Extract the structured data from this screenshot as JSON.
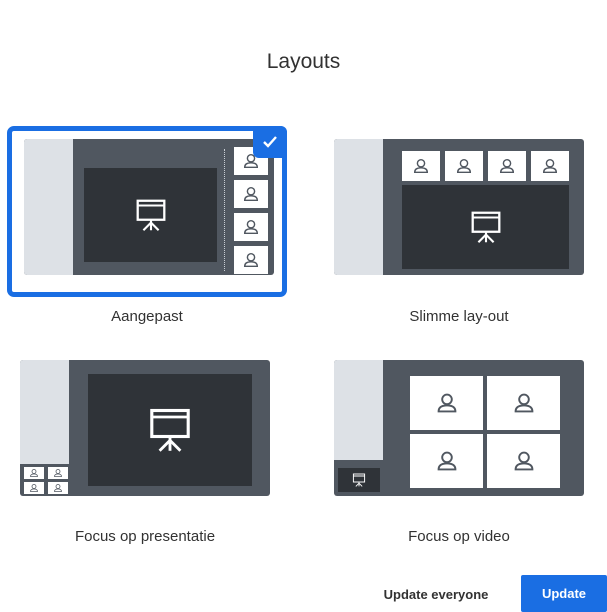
{
  "dialog": {
    "title": "Layouts"
  },
  "layouts": [
    {
      "label": "Aangepast",
      "selected": true
    },
    {
      "label": "Slimme lay-out",
      "selected": false
    },
    {
      "label": "Focus op presentatie",
      "selected": false
    },
    {
      "label": "Focus op video",
      "selected": false
    }
  ],
  "footer": {
    "update_everyone_label": "Update everyone",
    "update_label": "Update"
  },
  "colors": {
    "accent": "#1a6ee3",
    "thumb_bg": "#505760",
    "screen": "#2f3338",
    "sidebar": "#dde1e6"
  },
  "icons": {
    "presentation": "presentation-board-icon",
    "person": "person-icon",
    "check": "check-icon"
  }
}
